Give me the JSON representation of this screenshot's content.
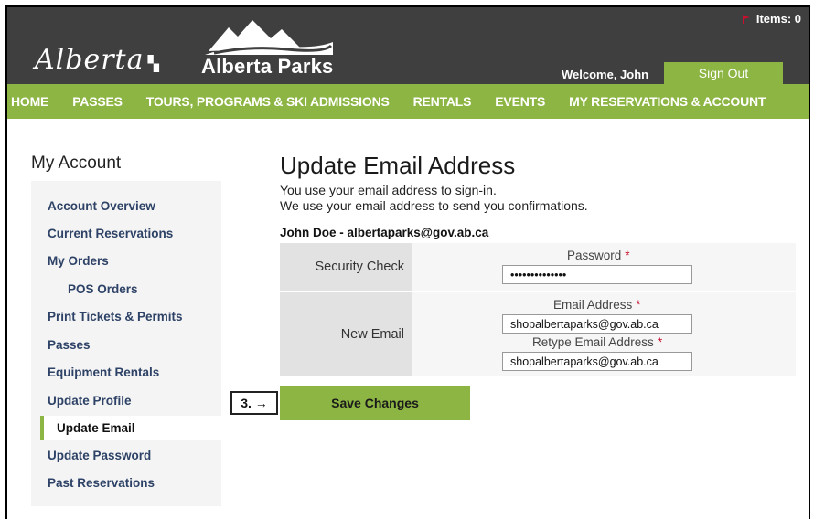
{
  "header": {
    "cart_label": "Items: 0",
    "brand_script": "Alberta",
    "brand_parks": "Alberta Parks",
    "welcome": "Welcome, John",
    "sign_out": "Sign Out"
  },
  "nav": [
    {
      "label": "HOME"
    },
    {
      "label": "PASSES"
    },
    {
      "label": "TOURS, PROGRAMS & SKI ADMISSIONS"
    },
    {
      "label": "RENTALS"
    },
    {
      "label": "EVENTS"
    },
    {
      "label": "MY RESERVATIONS & ACCOUNT"
    }
  ],
  "sidebar": {
    "title": "My Account",
    "items": [
      {
        "label": "Account Overview"
      },
      {
        "label": "Current Reservations"
      },
      {
        "label": "My Orders"
      },
      {
        "label": "POS Orders"
      },
      {
        "label": "Print Tickets & Permits"
      },
      {
        "label": "Passes"
      },
      {
        "label": "Equipment Rentals"
      },
      {
        "label": "Update Profile"
      },
      {
        "label": "Update Email"
      },
      {
        "label": "Update Password"
      },
      {
        "label": "Past Reservations"
      }
    ],
    "active_item": "Update Email"
  },
  "main": {
    "title": "Update Email Address",
    "desc1": "You use your email address to sign-in.",
    "desc2": "We use your email address to send you confirmations.",
    "user_line": "John Doe - albertaparks@gov.ab.ca",
    "security_label": "Security Check",
    "password_label": "Password",
    "password_value": "••••••••••••••",
    "new_email_label": "New Email",
    "email_label": "Email Address",
    "email_value": "shopalbertaparks@gov.ab.ca",
    "retype_label": "Retype Email Address",
    "retype_value": "shopalbertaparks@gov.ab.ca",
    "required_mark": "*",
    "save_label": "Save Changes"
  },
  "annotation": {
    "step_label": "3. →"
  },
  "colors": {
    "header_bg": "#3f3f3f",
    "accent_green": "#8db543",
    "link_navy": "#2d4266",
    "required_red": "#c8102e"
  }
}
